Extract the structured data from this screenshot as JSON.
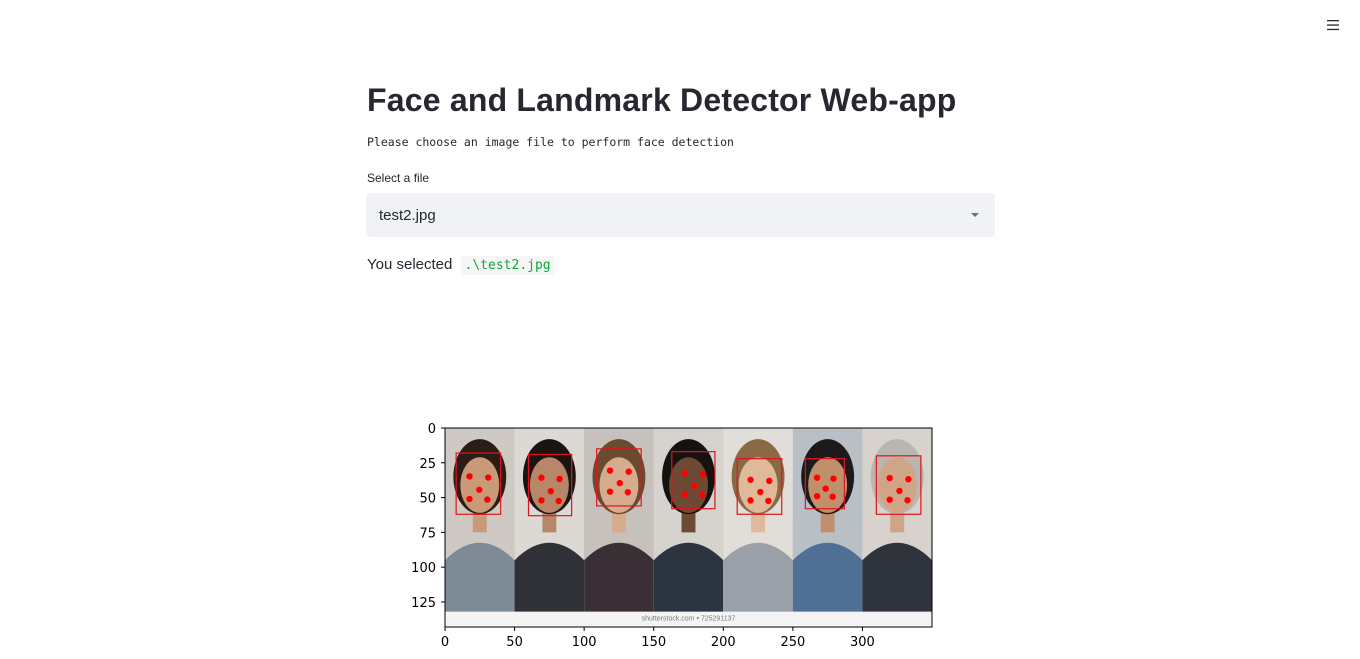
{
  "app": {
    "title": "Face and Landmark Detector Web-app",
    "subtitle": "Please choose an image file to perform face detection"
  },
  "file_select": {
    "label": "Select a file",
    "value": "test2.jpg"
  },
  "selection": {
    "prefix": "You selected",
    "path": ".\\test2.jpg"
  },
  "menu": {
    "icon": "hamburger-icon"
  },
  "figure": {
    "image_caption": "shutterstock.com • 725291137",
    "x_ticks": [
      0,
      50,
      100,
      150,
      200,
      250,
      300
    ],
    "y_ticks": [
      0,
      25,
      50,
      75,
      100,
      125
    ],
    "x_range": [
      0,
      350
    ],
    "y_range": [
      0,
      143
    ],
    "faces": [
      {
        "x": 8,
        "y": 18,
        "w": 32,
        "h": 44
      },
      {
        "x": 60,
        "y": 19,
        "w": 31,
        "h": 44
      },
      {
        "x": 109,
        "y": 15,
        "w": 32,
        "h": 41
      },
      {
        "x": 163,
        "y": 17,
        "w": 31,
        "h": 41
      },
      {
        "x": 210,
        "y": 22,
        "w": 32,
        "h": 40
      },
      {
        "x": 259,
        "y": 22,
        "w": 28,
        "h": 36
      },
      {
        "x": 310,
        "y": 20,
        "w": 32,
        "h": 42
      }
    ],
    "colors": {
      "box": "#e0141e",
      "landmark": "#ff0000",
      "axes": "#000000"
    }
  }
}
